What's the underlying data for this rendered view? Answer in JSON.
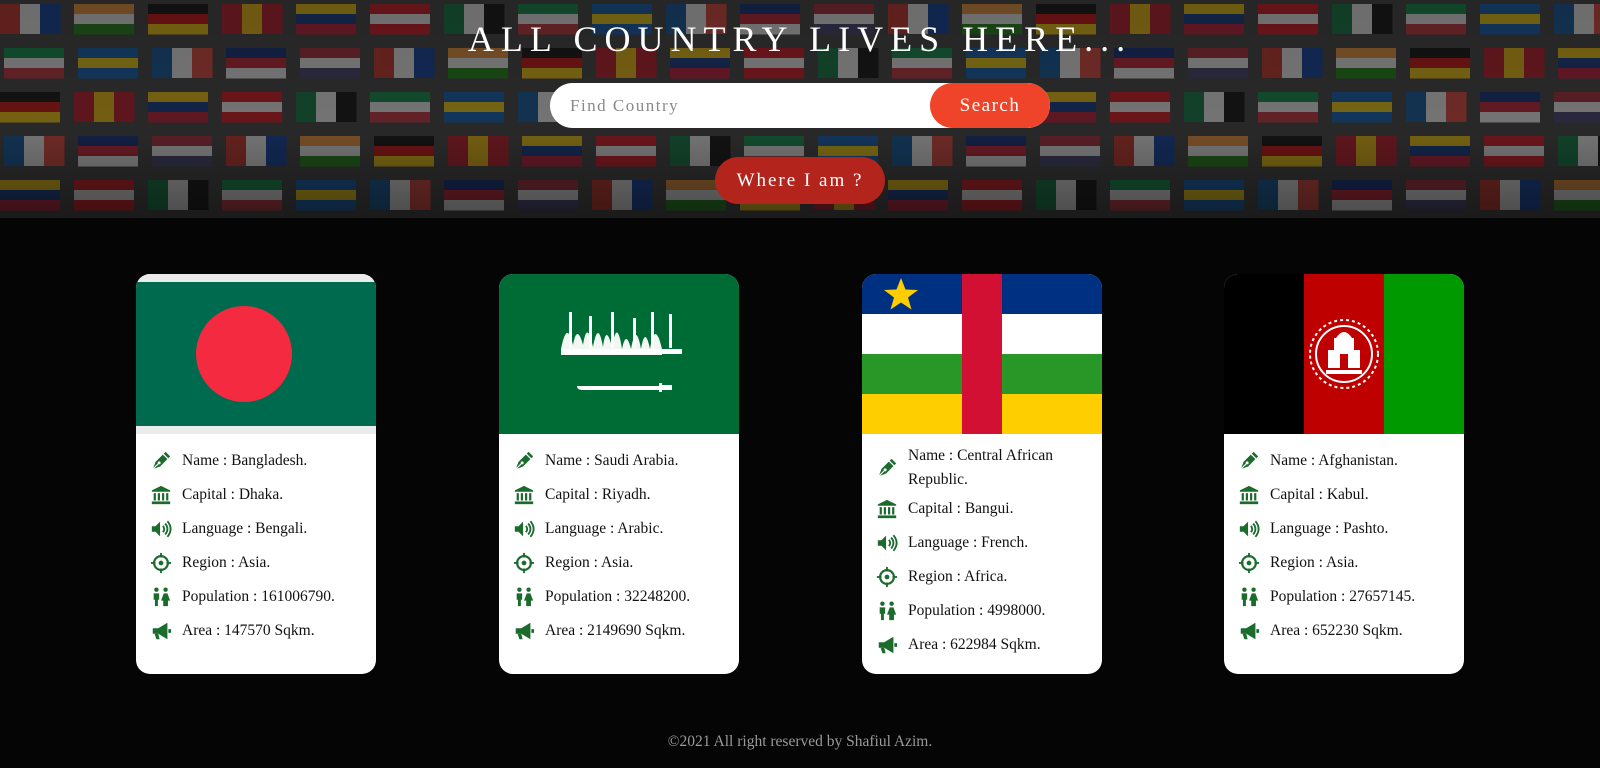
{
  "hero": {
    "title": "ALL COUNTRY LIVES HERE...",
    "search_placeholder": "Find Country",
    "search_label": "Search",
    "where_label": "Where I am ?"
  },
  "colors": {
    "accent": "#f0442a",
    "where_button": "#b3251c",
    "icon_green": "#1b6b2d",
    "page_background": "#050505"
  },
  "cards": [
    {
      "flag": "bangladesh-flag",
      "name": "Name : Bangladesh.",
      "capital": "Capital : Dhaka.",
      "language": "Language : Bengali.",
      "region": "Region : Asia.",
      "population": "Population : 161006790.",
      "area": "Area : 147570 Sqkm."
    },
    {
      "flag": "saudi-arabia-flag",
      "name": "Name : Saudi Arabia.",
      "capital": "Capital : Riyadh.",
      "language": "Language : Arabic.",
      "region": "Region : Asia.",
      "population": "Population : 32248200.",
      "area": "Area : 2149690 Sqkm."
    },
    {
      "flag": "central-african-republic-flag",
      "name": "Name : Central African Republic.",
      "capital": "Capital : Bangui.",
      "language": "Language : French.",
      "region": "Region : Africa.",
      "population": "Population : 4998000.",
      "area": "Area : 622984 Sqkm."
    },
    {
      "flag": "afghanistan-flag",
      "name": "Name : Afghanistan.",
      "capital": "Capital : Kabul.",
      "language": "Language : Pashto.",
      "region": "Region : Asia.",
      "population": "Population : 27657145.",
      "area": "Area : 652230 Sqkm."
    }
  ],
  "icons": {
    "name": "pen-nib-icon",
    "capital": "landmark-icon",
    "language": "volume-icon",
    "region": "crosshair-icon",
    "population": "people-icon",
    "area": "megaphone-icon"
  },
  "footer": {
    "text": "©2021 All right reserved by Shafiul Azim."
  }
}
